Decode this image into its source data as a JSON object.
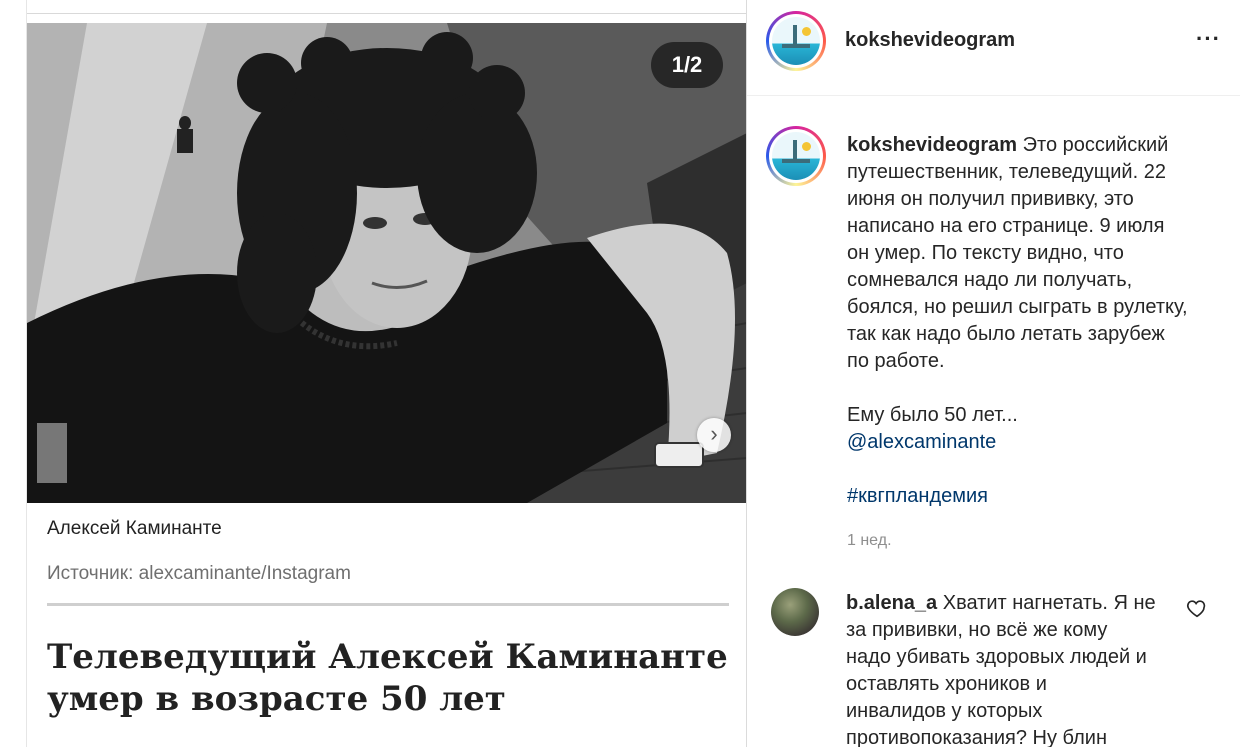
{
  "media": {
    "slide_counter": "1/2",
    "caption": "Алексей Каминанте",
    "source": "Источник: alexcaminante/Instagram",
    "headline_line1": "Телеведущий Алексей Каминанте",
    "headline_line2": "умер в возрасте 50 лет",
    "next_icon": "chevron-right-icon"
  },
  "post": {
    "username": "kokshevideogram",
    "more_icon": "···",
    "caption_username": "kokshevideogram",
    "caption_lines": [
      "Это российский",
      "путешественник, телеведущий. 22",
      "июня он получил прививку, это",
      "написано на его странице. 9 июля",
      "он умер. По тексту видно, что",
      "сомневался надо ли получать,",
      "боялся, но решил сыграть в рулетку,",
      "так как надо было летать зарубеж",
      "по работе."
    ],
    "age_line": "Ему было 50 лет...",
    "mention": "@alexcaminante",
    "hashtag": "#квгпландемия",
    "time": "1 нед."
  },
  "comment": {
    "username": "b.alena_a",
    "lines": [
      "Хватит нагнетать. Я не",
      "за прививки, но всё же кому",
      "надо убивать здоровых людей и",
      "оставлять хроников и",
      "инвалидов у которых",
      "противопоказания? Ну блин"
    ],
    "like_icon": "heart-icon"
  },
  "colors": {
    "link": "#00376b",
    "muted": "#8e8e8e",
    "text": "#262626"
  }
}
